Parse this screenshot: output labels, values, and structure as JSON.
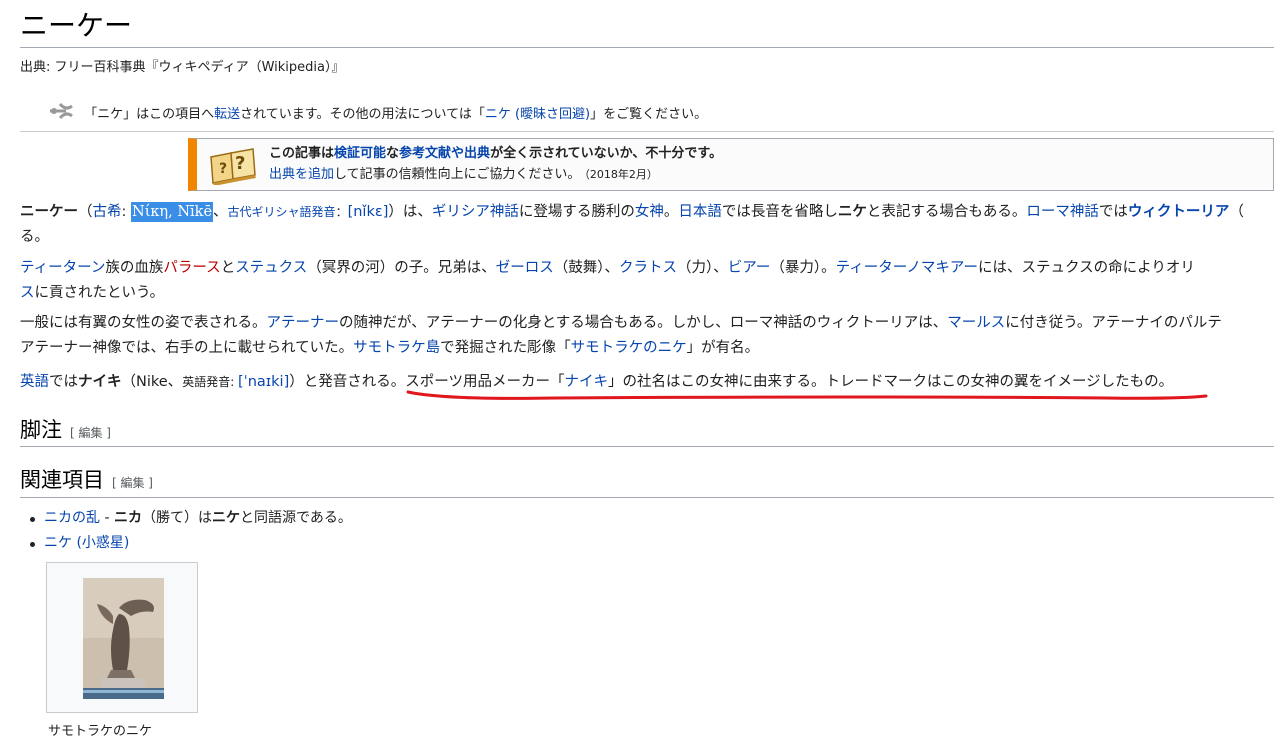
{
  "page": {
    "title": "ニーケー",
    "site_sub": "出典: フリー百科事典『ウィキペディア（Wikipedia）』"
  },
  "hatnote": {
    "before": "「ニケ」はこの項目へ",
    "redirect_link": "転送",
    "middle": "されています。その他の用法については「",
    "disambig_link": "ニケ (曖昧さ回避)",
    "after": "」をご覧ください。"
  },
  "ambox": {
    "line1_a": "この記事は",
    "line1_link1": "検証可能",
    "line1_b": "な",
    "line1_link2": "参考文献や出典",
    "line1_c": "が全く示されていないか、不十分です。",
    "line2_link": "出典を追加",
    "line2_text": "して記事の信頼性向上にご協力ください。",
    "date": "（2018年2月）"
  },
  "para1": {
    "line1": {
      "bold": "ニーケー",
      "t1": "（",
      "l_ancient_greek": "古希",
      "t2": ": ",
      "selected": "Νίκη, Nīkē",
      "t3": "、",
      "l_pron_label": "古代ギリシャ語発音",
      "t4": "：",
      "l_ipa": "[nǐkɛ]",
      "t5": "）は、",
      "l_greek_myth": "ギリシア神話",
      "t6": "に登場する勝利の",
      "l_goddess": "女神",
      "t7": "。",
      "l_japanese": "日本語",
      "t8": "では長音を省略し",
      "bold2": "ニケ",
      "t9": "と表記する場合もある。",
      "l_roman_myth": "ローマ神話",
      "t10": "では",
      "l_victoria": "ウィクトーリア",
      "t11": "（"
    },
    "line2": "る。"
  },
  "para2": {
    "line1": {
      "l_titan": "ティーターン",
      "t1": "族の血族",
      "l_pallas": "パラース",
      "t2": "と",
      "l_styx": "ステュクス",
      "t3": "（冥界の河）の子。兄弟は、",
      "l_zelos": "ゼーロス",
      "t4": "（鼓舞）、",
      "l_kratos": "クラトス",
      "t5": "（力）、",
      "l_bia": "ビアー",
      "t6": "（暴力）。",
      "l_titanomachy": "ティーターノマキアー",
      "t7": "には、ステュクスの命によりオリ"
    },
    "line2_link": "ス",
    "line2_text": "に貢されたという。"
  },
  "para3": {
    "line1": {
      "t1": "一般には有翼の女性の姿で表される。",
      "l_athena": "アテーナー",
      "t2": "の随神だが、アテーナーの化身とする場合もある。しかし、ローマ神話のウィクトーリアは、",
      "l_mars": "マールス",
      "t3": "に付き従う。アテーナイのパルテ"
    },
    "line2": {
      "t1": "アテーナー神像では、右手の上に載せられていた。",
      "l_samothrace": "サモトラケ島",
      "t2": "で発掘された彫像「",
      "l_winged_victory": "サモトラケのニケ",
      "t3": "」が有名。"
    }
  },
  "para4": {
    "l_english": "英語",
    "t1": "では",
    "bold": "ナイキ",
    "t2": "（Nike、",
    "small": "英語発音: ",
    "l_ipa": "[ˈnaɪki]",
    "t3": "）と発音される。スポーツ用品メーカー「",
    "l_nike_inc": "ナイキ",
    "t4": "」の社名はこの女神に由来する。トレードマークはこの女神の翼をイメージしたもの。"
  },
  "sections": {
    "notes": {
      "title": "脚注",
      "edit": "[ 編集 ]"
    },
    "related": {
      "title": "関連項目",
      "edit": "[ 編集 ]"
    }
  },
  "related_items": [
    {
      "link": "ニカの乱",
      "sep": " - ",
      "bold": "ニカ",
      "text": "（勝て）は",
      "bold2": "ニケ",
      "text2": "と同語源である。"
    },
    {
      "link": "ニケ (小惑星)"
    }
  ],
  "thumbnail": {
    "caption": "サモトラケのニケ"
  },
  "colors": {
    "link": "#0645ad",
    "redlink": "#ba0000",
    "ambox_border": "#f28500",
    "selection": "#3a8ee6",
    "annotation_underline": "#e0171c"
  },
  "icons": {
    "hatnote": "redirect-arrow-icon",
    "ambox": "open-book-question-icon"
  }
}
